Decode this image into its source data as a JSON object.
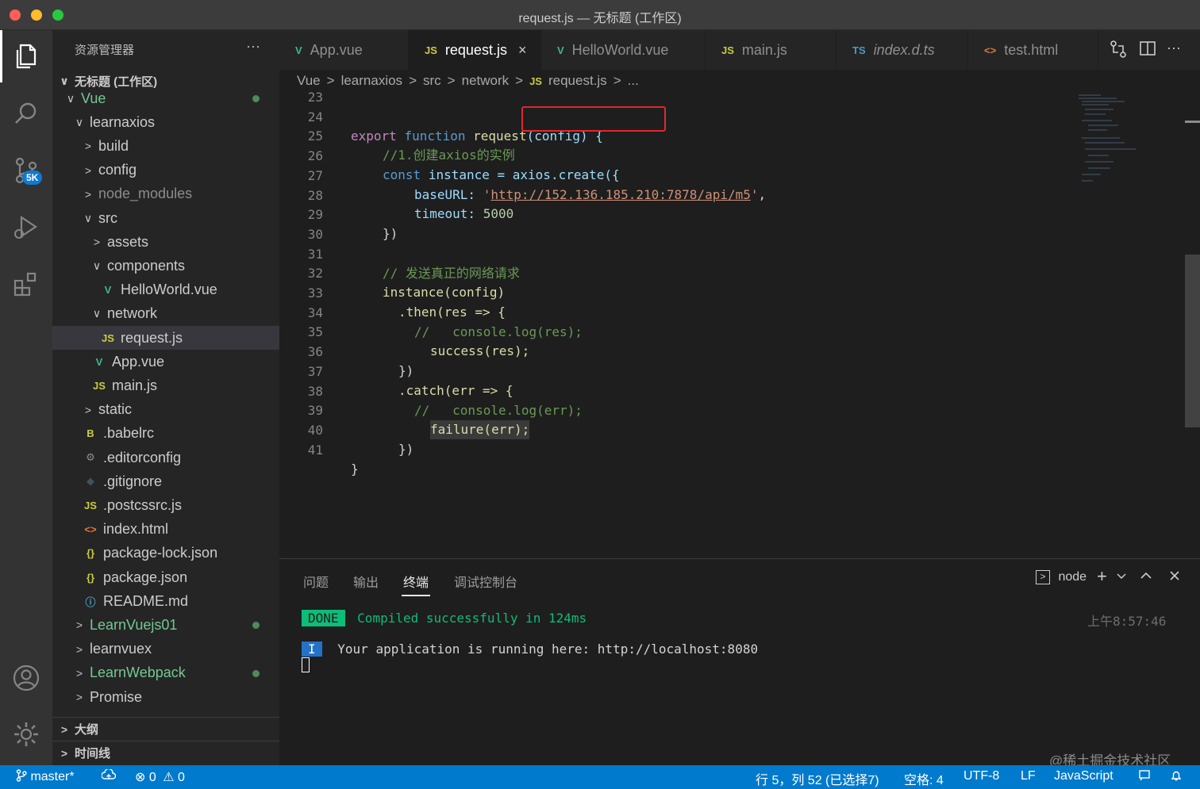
{
  "window": {
    "title": "request.js — 无标题 (工作区)"
  },
  "activity_bar": {
    "items": [
      "explorer-icon",
      "search-icon",
      "source-control-icon",
      "run-debug-icon",
      "extensions-icon",
      "account-icon",
      "gear-icon"
    ],
    "source_control_badge": "5K"
  },
  "sidebar": {
    "header": "资源管理器",
    "more": "···",
    "workspace": "无标题 (工作区)",
    "tree": [
      {
        "label": "Vue",
        "chevron": "∨",
        "icon": "",
        "git": true
      },
      {
        "label": "learnaxios",
        "chevron": "∨",
        "icon": ""
      },
      {
        "label": "build",
        "chevron": ">",
        "icon": ""
      },
      {
        "label": "config",
        "chevron": ">",
        "icon": ""
      },
      {
        "label": "node_modules",
        "chevron": ">",
        "icon": ""
      },
      {
        "label": "src",
        "chevron": "∨",
        "icon": ""
      },
      {
        "label": "assets",
        "chevron": ">",
        "icon": ""
      },
      {
        "label": "components",
        "chevron": "∨",
        "icon": ""
      },
      {
        "label": "HelloWorld.vue",
        "chevron": "",
        "icon": "V"
      },
      {
        "label": "network",
        "chevron": "∨",
        "icon": ""
      },
      {
        "label": "request.js",
        "chevron": "",
        "icon": "JS"
      },
      {
        "label": "App.vue",
        "chevron": "",
        "icon": "V"
      },
      {
        "label": "main.js",
        "chevron": "",
        "icon": "JS"
      },
      {
        "label": "static",
        "chevron": ">",
        "icon": ""
      },
      {
        "label": ".babelrc",
        "chevron": "",
        "icon": "B"
      },
      {
        "label": ".editorconfig",
        "chevron": "",
        "icon": "⚙"
      },
      {
        "label": ".gitignore",
        "chevron": "",
        "icon": "◆"
      },
      {
        "label": ".postcssrc.js",
        "chevron": "",
        "icon": "JS"
      },
      {
        "label": "index.html",
        "chevron": "",
        "icon": "<>"
      },
      {
        "label": "package-lock.json",
        "chevron": "",
        "icon": "{}"
      },
      {
        "label": "package.json",
        "chevron": "",
        "icon": "{}"
      },
      {
        "label": "README.md",
        "chevron": "",
        "icon": "ⓘ"
      },
      {
        "label": "LearnVuejs01",
        "chevron": ">",
        "icon": "",
        "git": true
      },
      {
        "label": "learnvuex",
        "chevron": ">",
        "icon": ""
      },
      {
        "label": "LearnWebpack",
        "chevron": ">",
        "icon": "",
        "git": true
      },
      {
        "label": "Promise",
        "chevron": ">",
        "icon": ""
      }
    ],
    "sections": [
      "大纲",
      "时间线"
    ]
  },
  "tabs": [
    {
      "label": "App.vue",
      "icon": "V"
    },
    {
      "label": "request.js",
      "icon": "JS",
      "active": true
    },
    {
      "label": "HelloWorld.vue",
      "icon": "V"
    },
    {
      "label": "main.js",
      "icon": "JS"
    },
    {
      "label": "index.d.ts",
      "icon": "TS"
    },
    {
      "label": "test.html",
      "icon": "<>"
    }
  ],
  "tab_close": "×",
  "breadcrumb": [
    "Vue",
    "learnaxios",
    "src",
    "network",
    "request.js",
    "..."
  ],
  "editor": {
    "lines": [
      23,
      24,
      25,
      26,
      27,
      28,
      29,
      30,
      31,
      32,
      33,
      34,
      35,
      36,
      37,
      38,
      39,
      40,
      41
    ],
    "code": {
      "l24_export": "export",
      "l24_function": "function",
      "l24_name": "request",
      "l24_params": "(config) {",
      "l25": "//1.创建axios的实例",
      "l26_const": "const",
      "l26_rest": "instance = axios.create({",
      "l27_key": "baseURL:",
      "l27_url": "http://152.136.185.210:7878/api/m5",
      "l28_key": "timeout:",
      "l28_val": "5000",
      "l29": "})",
      "l31": "// 发送真正的网络请求",
      "l32": "instance(config)",
      "l33": ".then(res => {",
      "l34": "//   console.log(res);",
      "l35": "success(res);",
      "l36": "})",
      "l37": ".catch(err => {",
      "l38": "//   console.log(err);",
      "l39": "failure(err);",
      "l40": "})",
      "l41": "}"
    }
  },
  "panel": {
    "tabs": [
      "问题",
      "输出",
      "终端",
      "调试控制台"
    ],
    "active_tab": "终端",
    "terminal_name": "node",
    "plus": "+",
    "done": "DONE",
    "compiled": "Compiled successfully in 124ms",
    "time": "上午8:57:46",
    "info_tag": "I",
    "running": "Your application is running here: http://localhost:8080"
  },
  "status_bar": {
    "branch": "master*",
    "errors": "0",
    "warnings": "0",
    "position": "行 5，列 52 (已选择7)",
    "spaces": "空格: 4",
    "encoding": "UTF-8",
    "eol": "LF",
    "language": "JavaScript"
  },
  "watermark": "@稀土掘金技术社区",
  "colors": {
    "accent": "#007acc",
    "highlight_box": "#e0282e",
    "terminal_green": "#0dbc79"
  }
}
